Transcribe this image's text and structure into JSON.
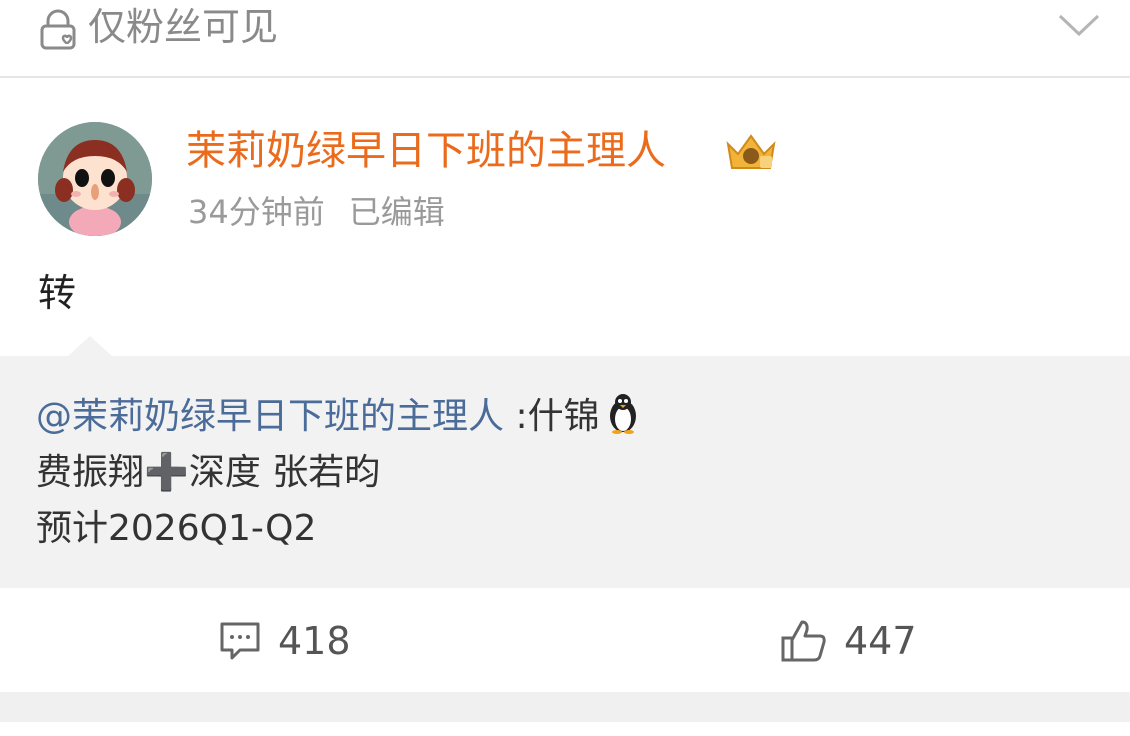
{
  "header": {
    "visibility_label": "仅粉丝可见",
    "lock_icon": "lock-heart-icon",
    "expand_icon": "chevron-down-icon"
  },
  "post": {
    "author": "茉莉奶绿早日下班的主理人",
    "badge_icon": "crown-badge-icon",
    "time": "34分钟前",
    "edited_label": "已编辑",
    "text": "转"
  },
  "repost": {
    "mention": "@茉莉奶绿早日下班的主理人",
    "line1_suffix": " :什锦",
    "line1_emoji": "penguin-icon",
    "line2": "费振翔➕深度 张若昀",
    "line3": "预计2026Q1-Q2"
  },
  "actions": {
    "comment_icon": "comment-icon",
    "comment_count": "418",
    "like_icon": "thumbs-up-icon",
    "like_count": "447"
  },
  "colors": {
    "author": "#eb6b1c",
    "mention": "#4b6b99",
    "meta": "#9a9a9a",
    "repost_bg": "#f2f2f2"
  }
}
